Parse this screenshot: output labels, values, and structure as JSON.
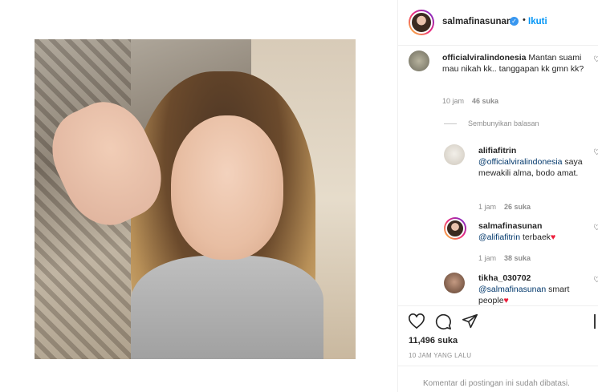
{
  "post": {
    "author": "salmafinasunan",
    "follow_dot": "•",
    "follow_label": "Ikuti"
  },
  "comments": [
    {
      "user": "officialviralindonesia",
      "text": "Mantan suami mau nikah kk.. tanggapan kk gmn kk?",
      "time": "10 jam",
      "likes": "46 suka"
    }
  ],
  "hide_replies_label": "Sembunyikan balasan",
  "replies": [
    {
      "user": "alifiafitrin",
      "mention": "@officialviralindonesia",
      "text": "saya mewakili alma, bodo amat.",
      "time": "1 jam",
      "likes": "26 suka"
    },
    {
      "user": "salmafinasunan",
      "mention": "@alifiafitrin",
      "text": "terbaek",
      "emoji": "♥",
      "time": "1 jam",
      "likes": "38 suka"
    },
    {
      "user": "tikha_030702",
      "mention": "@salmafinasunan",
      "text": "smart people",
      "emoji": "♥"
    }
  ],
  "actions": {
    "likes_count": "11,496 suka",
    "timestamp": "10 JAM YANG LALU",
    "comments_disabled": "Komentar di postingan ini sudah dibatasi."
  },
  "icons": [
    "heart-icon",
    "comment-icon",
    "share-icon",
    "bookmark-icon",
    "verified-icon"
  ],
  "colors": {
    "link": "#0095f6",
    "mention": "#00376b",
    "muted": "#8e8e8e",
    "heart_red": "#ed1c3a"
  }
}
